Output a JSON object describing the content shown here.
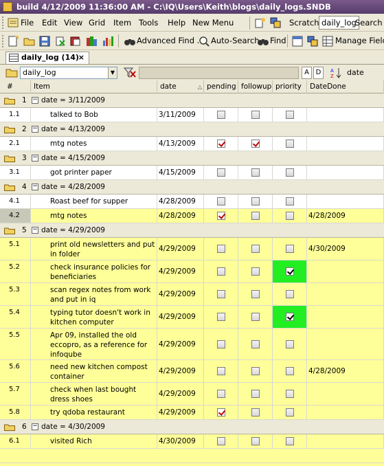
{
  "window": {
    "title": "build 4/12/2009 11:36:00 AM - C:\\IQ\\Users\\Keith\\blogs\\daily_logs.SNDB"
  },
  "menubar": {
    "items": [
      "File",
      "Edit",
      "View",
      "Grid",
      "Item",
      "Tools",
      "Help",
      "New Menu"
    ],
    "right": [
      "Scratch",
      "daily_log",
      "Search"
    ]
  },
  "toolbar": {
    "advanced_find": "Advanced Find ...",
    "auto_search": "Auto-Search",
    "find": "Find",
    "manage_fields": "Manage Fields"
  },
  "tab": {
    "label": "daily_log (14)",
    "close": "×"
  },
  "filterbar": {
    "view": "daily_log",
    "sort_asc": "A",
    "sort_desc": "D",
    "sort_field": "date"
  },
  "columns": [
    "#",
    "Item",
    "date",
    "pending",
    "followup",
    "priority",
    "DateDone"
  ],
  "groups": [
    {
      "num": "1",
      "label": "date = 3/11/2009",
      "rows": [
        {
          "num": "1.1",
          "item": "talked to Bob",
          "date": "3/11/2009",
          "pending": false,
          "followup": false,
          "priority": false,
          "done": "",
          "h": 21,
          "hl": false,
          "green": false
        }
      ]
    },
    {
      "num": "2",
      "label": "date = 4/13/2009",
      "rows": [
        {
          "num": "2.1",
          "item": "mtg notes",
          "date": "4/13/2009",
          "pending": true,
          "followup": true,
          "priority": false,
          "done": "",
          "h": 21,
          "hl": false,
          "green": false
        }
      ]
    },
    {
      "num": "3",
      "label": "date = 4/15/2009",
      "rows": [
        {
          "num": "3.1",
          "item": "got printer paper",
          "date": "4/15/2009",
          "pending": false,
          "followup": false,
          "priority": false,
          "done": "",
          "h": 21,
          "hl": false,
          "green": false
        }
      ]
    },
    {
      "num": "4",
      "label": "date = 4/28/2009",
      "rows": [
        {
          "num": "4.1",
          "item": "Roast beef for supper",
          "date": "4/28/2009",
          "pending": false,
          "followup": false,
          "priority": false,
          "done": "",
          "h": 21,
          "hl": false,
          "green": false
        },
        {
          "num": "4.2",
          "item": "mtg notes",
          "date": "4/28/2009",
          "pending": true,
          "followup": false,
          "priority": false,
          "done": "4/28/2009",
          "h": 21,
          "hl": true,
          "green": false,
          "sel": true
        }
      ]
    },
    {
      "num": "5",
      "label": "date = 4/29/2009",
      "rows": [
        {
          "num": "5.1",
          "item": "print old newsletters and put in folder",
          "date": "4/29/2009",
          "pending": false,
          "followup": false,
          "priority": false,
          "done": "4/30/2009",
          "h": 33,
          "hl": true,
          "green": false
        },
        {
          "num": "5.2",
          "item": "check insurance policies for beneficiaries",
          "date": "4/29/2009",
          "pending": false,
          "followup": false,
          "priority": true,
          "done": "",
          "h": 33,
          "hl": true,
          "green": true
        },
        {
          "num": "5.3",
          "item": "scan regex notes from work and put in iq",
          "date": "4/29/2009",
          "pending": false,
          "followup": false,
          "priority": false,
          "done": "",
          "h": 33,
          "hl": true,
          "green": false
        },
        {
          "num": "5.4",
          "item": "typing tutor doesn't work in kitchen computer",
          "date": "4/29/2009",
          "pending": false,
          "followup": false,
          "priority": true,
          "done": "",
          "h": 33,
          "hl": true,
          "green": true
        },
        {
          "num": "5.5",
          "item": "Apr 09, installed the old eccopro, as a reference for infoqube",
          "date": "4/29/2009",
          "pending": false,
          "followup": false,
          "priority": false,
          "done": "",
          "h": 46,
          "hl": true,
          "green": false
        },
        {
          "num": "5.6",
          "item": "need new kitchen compost container",
          "date": "4/29/2009",
          "pending": false,
          "followup": false,
          "priority": false,
          "done": "4/28/2009",
          "h": 33,
          "hl": true,
          "green": false
        },
        {
          "num": "5.7",
          "item": "check when last bought dress shoes",
          "date": "4/29/2009",
          "pending": false,
          "followup": false,
          "priority": false,
          "done": "",
          "h": 33,
          "hl": true,
          "green": false
        },
        {
          "num": "5.8",
          "item": "try qdoba restaurant",
          "date": "4/29/2009",
          "pending": true,
          "followup": false,
          "priority": false,
          "done": "",
          "h": 21,
          "hl": true,
          "green": false
        }
      ]
    },
    {
      "num": "6",
      "label": "date = 4/30/2009",
      "rows": [
        {
          "num": "6.1",
          "item": "visited Rich",
          "date": "4/30/2009",
          "pending": false,
          "followup": false,
          "priority": false,
          "done": "",
          "h": 21,
          "hl": true,
          "green": false
        }
      ]
    }
  ]
}
